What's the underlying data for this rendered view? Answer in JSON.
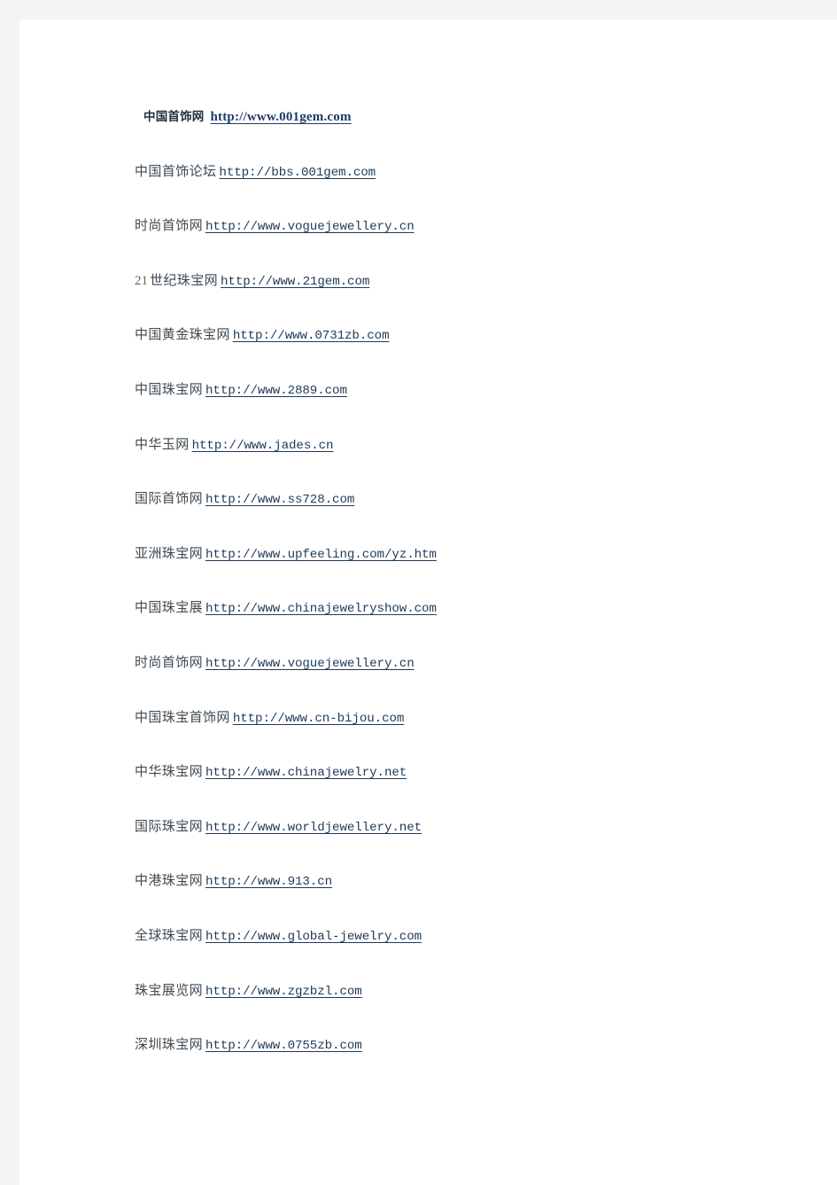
{
  "page": {
    "background_color": "#f4f4f5",
    "paper_color": "#ffffff",
    "label_color": "#3f4a52",
    "link_color": "#1f3b56",
    "heading_link_color": "#1f3864"
  },
  "links": [
    {
      "label": "中国首饰网",
      "url": "http://www.001gem.com",
      "heading": true
    },
    {
      "label": "中国首饰论坛",
      "url": "http://bbs.001gem.com",
      "heading": false
    },
    {
      "label": "时尚首饰网",
      "url": "http://www.voguejewellery.cn",
      "heading": false
    },
    {
      "label": "世纪珠宝网",
      "url": "http://www.21gem.com",
      "heading": false,
      "num_prefix": "21"
    },
    {
      "label": "中国黄金珠宝网",
      "url": "http://www.0731zb.com",
      "heading": false
    },
    {
      "label": "中国珠宝网",
      "url": "http://www.2889.com",
      "heading": false
    },
    {
      "label": "中华玉网",
      "url": "http://www.jades.cn",
      "heading": false
    },
    {
      "label": "国际首饰网",
      "url": "http://www.ss728.com",
      "heading": false
    },
    {
      "label": "亚洲珠宝网",
      "url": "http://www.upfeeling.com/yz.htm",
      "heading": false
    },
    {
      "label": "中国珠宝展",
      "url": "http://www.chinajewelryshow.com",
      "heading": false
    },
    {
      "label": "时尚首饰网",
      "url": "http://www.voguejewellery.cn",
      "heading": false
    },
    {
      "label": "中国珠宝首饰网",
      "url": "http://www.cn-bijou.com",
      "heading": false
    },
    {
      "label": "中华珠宝网",
      "url": "http://www.chinajewelry.net",
      "heading": false
    },
    {
      "label": "国际珠宝网",
      "url": "http://www.worldjewellery.net",
      "heading": false
    },
    {
      "label": "中港珠宝网",
      "url": "http://www.913.cn",
      "heading": false
    },
    {
      "label": "全球珠宝网",
      "url": "http://www.global-jewelry.com",
      "heading": false
    },
    {
      "label": "珠宝展览网",
      "url": "http://www.zgzbzl.com",
      "heading": false
    },
    {
      "label": "深圳珠宝网",
      "url": "http://www.0755zb.com",
      "heading": false
    }
  ]
}
